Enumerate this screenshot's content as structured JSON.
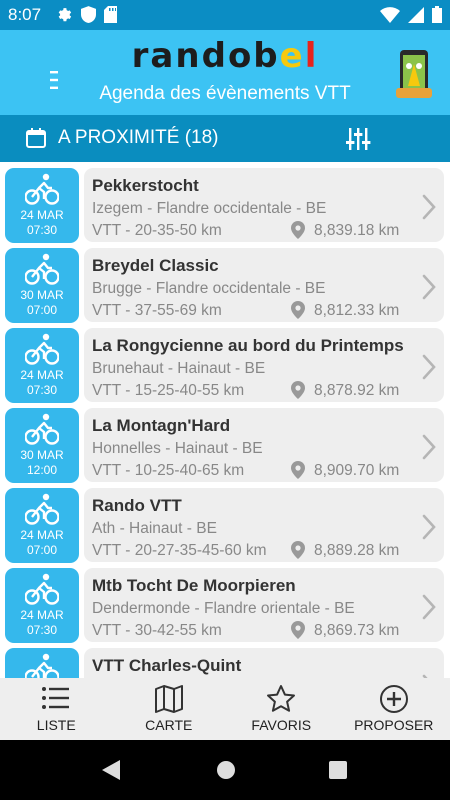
{
  "status_bar": {
    "time": "8:07",
    "icons_left": [
      "gear-icon",
      "shield-icon",
      "sd-card-icon"
    ],
    "icons_right": [
      "wifi-icon",
      "signal-icon",
      "battery-icon"
    ]
  },
  "header": {
    "logo_text": "randobel",
    "subtitle": "Agenda des évènements VTT"
  },
  "subheader": {
    "title": "A PROXIMITÉ (18)"
  },
  "events": [
    {
      "day": "24 MAR",
      "time": "07:30",
      "title": "Pekkerstocht",
      "location": "Izegem - Flandre occidentale - BE",
      "distances": "VTT - 20-35-50 km",
      "proximity": "8,839.18 km"
    },
    {
      "day": "30 MAR",
      "time": "07:00",
      "title": "Breydel Classic",
      "location": "Brugge - Flandre occidentale - BE",
      "distances": "VTT - 37-55-69 km",
      "proximity": "8,812.33 km"
    },
    {
      "day": "24 MAR",
      "time": "07:30",
      "title": "La Rongycienne au bord du Printemps",
      "location": "Brunehaut - Hainaut - BE",
      "distances": "VTT - 15-25-40-55 km",
      "proximity": "8,878.92 km"
    },
    {
      "day": "30 MAR",
      "time": "12:00",
      "title": "La Montagn'Hard",
      "location": "Honnelles - Hainaut - BE",
      "distances": "VTT - 10-25-40-65 km",
      "proximity": "8,909.70 km"
    },
    {
      "day": "24 MAR",
      "time": "07:00",
      "title": "Rando VTT",
      "location": "Ath - Hainaut - BE",
      "distances": "VTT - 20-27-35-45-60 km",
      "proximity": "8,889.28 km"
    },
    {
      "day": "24 MAR",
      "time": "07:30",
      "title": "Mtb Tocht De Moorpieren",
      "location": "Dendermonde - Flandre orientale - BE",
      "distances": "VTT - 30-42-55 km",
      "proximity": "8,869.73 km"
    },
    {
      "day": "",
      "time": "",
      "title": "VTT Charles-Quint",
      "location": "",
      "distances": "",
      "proximity": ""
    }
  ],
  "bottom_nav": [
    {
      "label": "LISTE",
      "icon": "list-icon"
    },
    {
      "label": "CARTE",
      "icon": "map-icon"
    },
    {
      "label": "FAVORIS",
      "icon": "star-icon"
    },
    {
      "label": "PROPOSER",
      "icon": "add-circle-icon"
    }
  ],
  "colors": {
    "header": "#3cc3f3",
    "subheader": "#0a8dbf",
    "status_bar": "#0b8dc4",
    "badge": "#35b8ec",
    "card": "#eeeeee"
  }
}
